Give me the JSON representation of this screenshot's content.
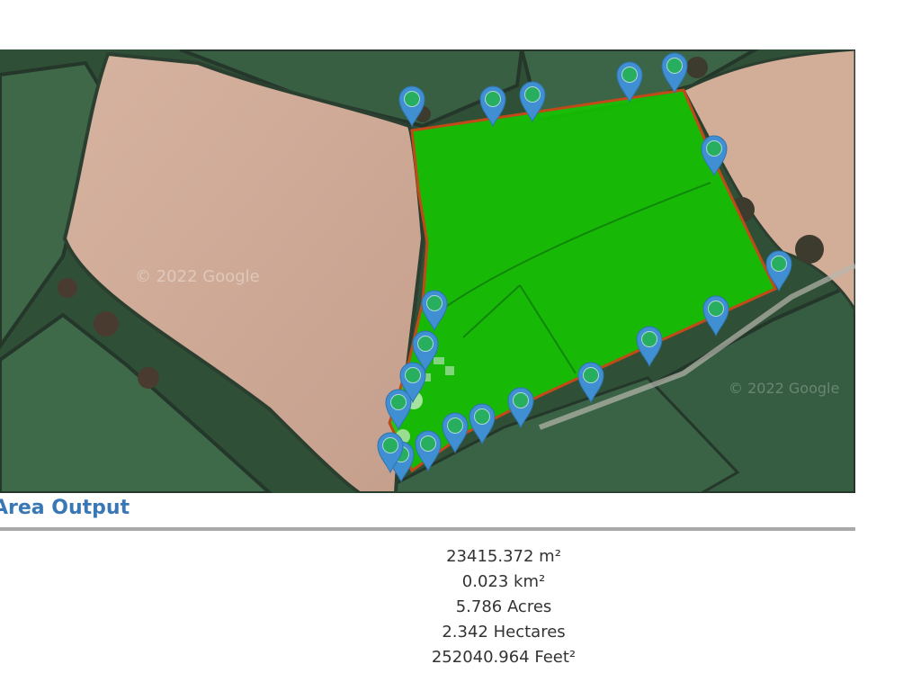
{
  "map": {
    "watermark": "© 2022 Google",
    "polygon_fill": "#14c800",
    "polygon_stroke": "#c24a18",
    "marker_color": "#3f8fd2",
    "marker_icon": "map-pin-icon",
    "marker_count": 20
  },
  "area_output": {
    "title": "Area Output",
    "accent_color": "#3a78b5",
    "results": [
      "23415.372 m²",
      "0.023 km²",
      "5.786 Acres",
      "2.342 Hectares",
      "252040.964 Feet²"
    ]
  }
}
